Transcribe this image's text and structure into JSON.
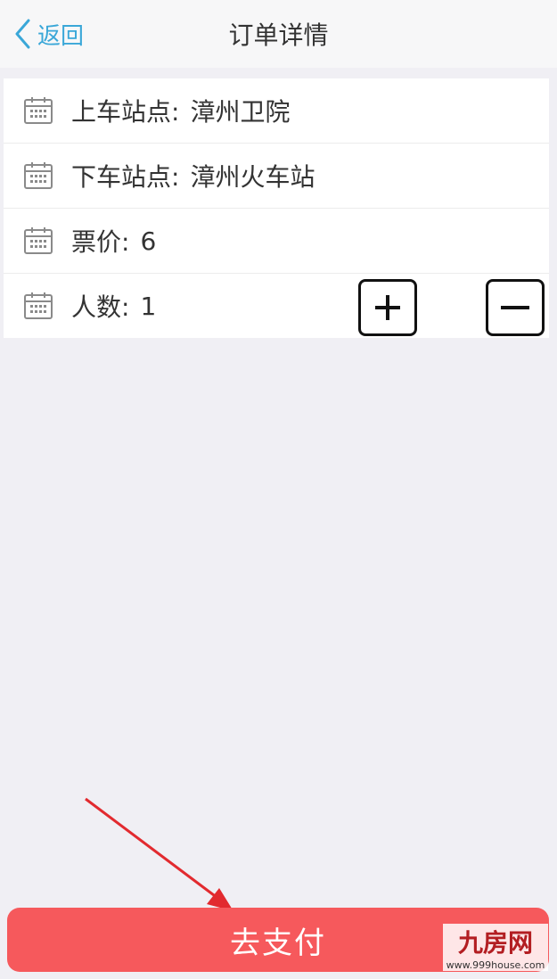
{
  "navbar": {
    "back_label": "返回",
    "title": "订单详情"
  },
  "form": {
    "rows": [
      {
        "label": "上车站点:",
        "value": "漳州卫院"
      },
      {
        "label": "下车站点:",
        "value": "漳州火车站"
      },
      {
        "label": "票价:",
        "value": "6"
      },
      {
        "label": "人数:",
        "value": "1"
      }
    ]
  },
  "stepper": {
    "plus_symbol": "+",
    "minus_symbol": "−"
  },
  "pay_button": {
    "label": "去支付"
  },
  "watermark": {
    "main": "九房网",
    "sub": "www.999house.com"
  },
  "icons": {
    "back": "chevron-left-icon",
    "row": "calendar-icon"
  },
  "colors": {
    "accent": "#3aa7d8",
    "pay": "#f6595c",
    "arrow": "#e22a2f",
    "background": "#f0eff4"
  }
}
